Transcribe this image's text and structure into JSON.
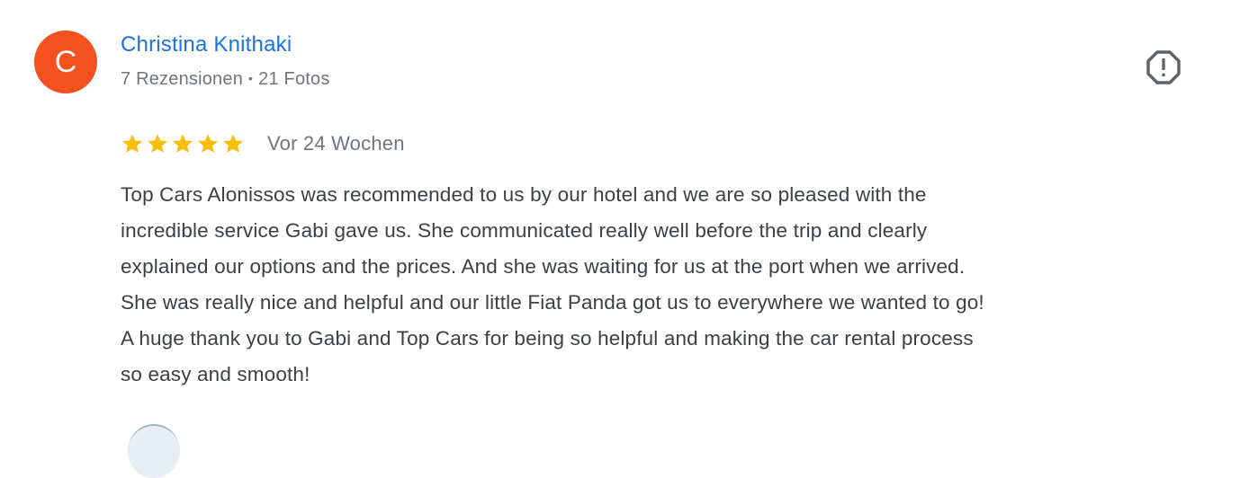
{
  "review": {
    "avatar_letter": "C",
    "author_name": "Christina Knithaki",
    "reviews_count": "7 Rezensionen",
    "separator": "•",
    "photos_count": "21 Fotos",
    "rating": 5,
    "rating_max": 5,
    "date": "Vor 24 Wochen",
    "text": "Top Cars Alonissos was recommended to us by our hotel and we are so pleased with the\nincredible service Gabi gave us. She communicated really well before the trip and clearly\nexplained our options and the prices. And she was waiting for us at the port when we arrived.\nShe was really nice and helpful and our little Fiat Panda got us to everywhere we wanted to go!\nA huge thank you to Gabi and Top Cars for being so helpful and making the car rental process\nso easy and smooth!"
  },
  "icons": {
    "report": "report-flag-icon",
    "star": "star-icon"
  },
  "colors": {
    "avatar_bg": "#f4511e",
    "author_link": "#1a73e8",
    "meta_text": "#70757a",
    "body_text": "#3c4043",
    "star_fill": "#fbbc04"
  }
}
